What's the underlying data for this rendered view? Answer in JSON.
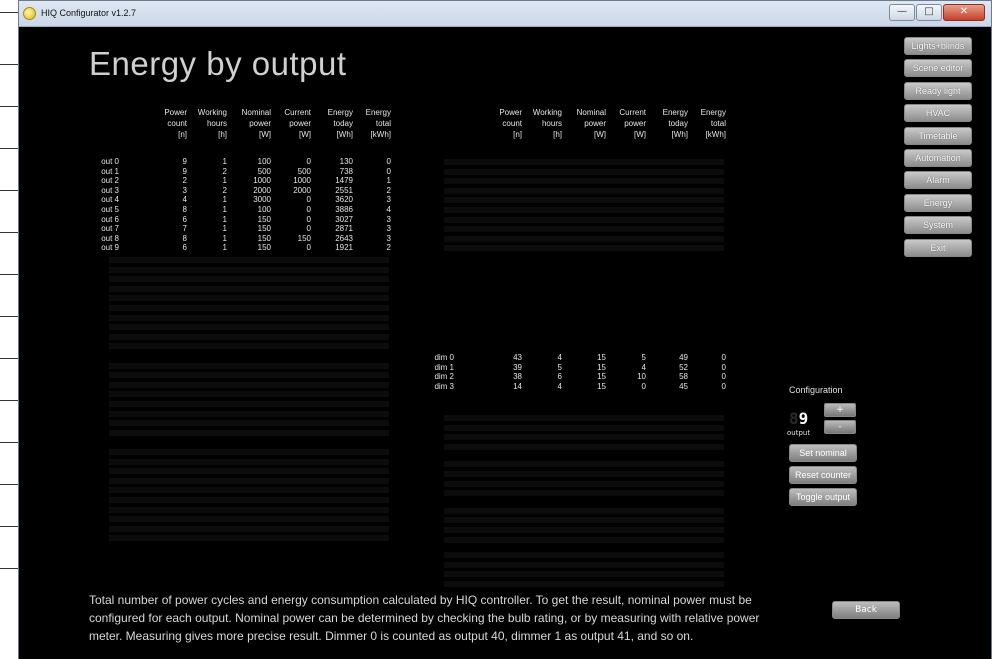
{
  "window": {
    "title": "HIQ Configurator v1.2.7",
    "controls": [
      "—",
      "□",
      "✕"
    ]
  },
  "page": {
    "title": "Energy by output"
  },
  "columns": [
    [
      "Power",
      "count",
      "[n]"
    ],
    [
      "Working",
      "hours",
      "[h]"
    ],
    [
      "Nominal",
      "power",
      "[W]"
    ],
    [
      "Current",
      "power",
      "[W]"
    ],
    [
      "Energy",
      "today",
      "[Wh]"
    ],
    [
      "Energy",
      "total",
      "[kWh]"
    ]
  ],
  "outputs": [
    {
      "label": "out 0",
      "values": [
        "9",
        "1",
        "100",
        "0",
        "130",
        "0"
      ]
    },
    {
      "label": "out 1",
      "values": [
        "9",
        "2",
        "500",
        "500",
        "738",
        "0"
      ]
    },
    {
      "label": "out 2",
      "values": [
        "2",
        "1",
        "1000",
        "1000",
        "1479",
        "1"
      ]
    },
    {
      "label": "out 3",
      "values": [
        "3",
        "2",
        "2000",
        "2000",
        "2551",
        "2"
      ]
    },
    {
      "label": "out 4",
      "values": [
        "4",
        "1",
        "3000",
        "0",
        "3620",
        "3"
      ]
    },
    {
      "label": "out 5",
      "values": [
        "8",
        "1",
        "100",
        "0",
        "3886",
        "4"
      ]
    },
    {
      "label": "out 6",
      "values": [
        "6",
        "1",
        "150",
        "0",
        "3027",
        "3"
      ]
    },
    {
      "label": "out 7",
      "values": [
        "7",
        "1",
        "150",
        "0",
        "2871",
        "3"
      ]
    },
    {
      "label": "out 8",
      "values": [
        "8",
        "1",
        "150",
        "150",
        "2643",
        "3"
      ]
    },
    {
      "label": "out 9",
      "values": [
        "6",
        "1",
        "150",
        "0",
        "1921",
        "2"
      ]
    }
  ],
  "dimmers": [
    {
      "label": "dim 0",
      "values": [
        "43",
        "4",
        "15",
        "5",
        "49",
        "0"
      ]
    },
    {
      "label": "dim 1",
      "values": [
        "39",
        "5",
        "15",
        "4",
        "52",
        "0"
      ]
    },
    {
      "label": "dim 2",
      "values": [
        "38",
        "6",
        "15",
        "10",
        "58",
        "0"
      ]
    },
    {
      "label": "dim 3",
      "values": [
        "14",
        "4",
        "15",
        "0",
        "45",
        "0"
      ]
    }
  ],
  "sidebar": {
    "buttons": [
      "Lights+blinds",
      "Scene editor",
      "Ready light",
      "HVAC",
      "Timetable",
      "Automation",
      "Alarm",
      "Energy",
      "System",
      "Exit"
    ]
  },
  "configuration": {
    "label": "Configuration",
    "digit_off": "8",
    "digit_on": "9",
    "output_label": "output",
    "plus": "+",
    "minus": "-",
    "set_nominal": "Set nominal",
    "reset_counter": "Reset counter",
    "toggle_output": "Toggle output"
  },
  "description": "Total number of power cycles and energy consumption calculated by HIQ controller. To get the result, nominal power must be configured for each output. Nominal power can be determined by checking the bulb rating, or by measuring with relative power meter. Measuring gives more precise result. Dimmer 0 is counted as output 40, dimmer 1 as output 41, and so on.",
  "back_label": "Back",
  "colors": {
    "background": "#000000",
    "text": "#e6e6e6",
    "button": "#a0a0a0"
  }
}
